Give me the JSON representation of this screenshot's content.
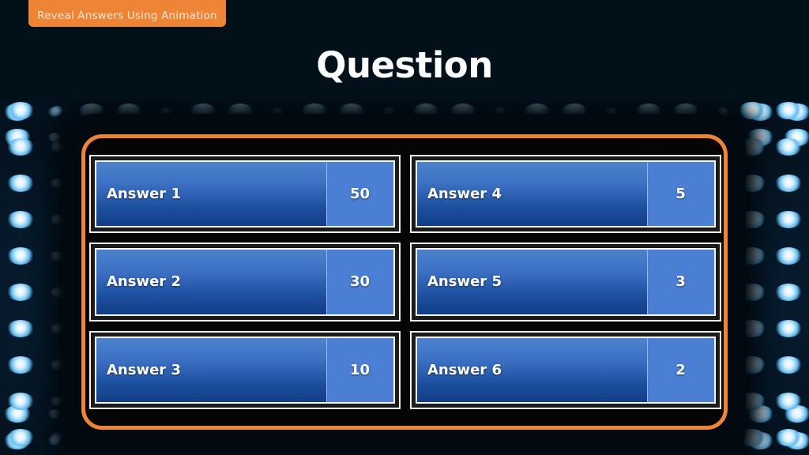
{
  "tab": {
    "label": "Reveal Answers Using Animation",
    "color": "#ee8436"
  },
  "header": {
    "title": "Question"
  },
  "theme": {
    "background": "#021019",
    "frame_accent": "#ee8436",
    "bar_blue_light": "#4d82cd",
    "bar_blue_dark": "#113d84",
    "score_blue": "#4a7fd4",
    "panel_border": "#f2f2f2",
    "bulb_glow": "#66bdf0"
  },
  "board": {
    "answers": [
      {
        "label": "Answer 1",
        "score": "50",
        "position": "left-1"
      },
      {
        "label": "Answer 2",
        "score": "30",
        "position": "left-2"
      },
      {
        "label": "Answer 3",
        "score": "10",
        "position": "left-3"
      },
      {
        "label": "Answer 4",
        "score": "5",
        "position": "right-1"
      },
      {
        "label": "Answer 5",
        "score": "3",
        "position": "right-2"
      },
      {
        "label": "Answer 6",
        "score": "2",
        "position": "right-3"
      }
    ]
  }
}
